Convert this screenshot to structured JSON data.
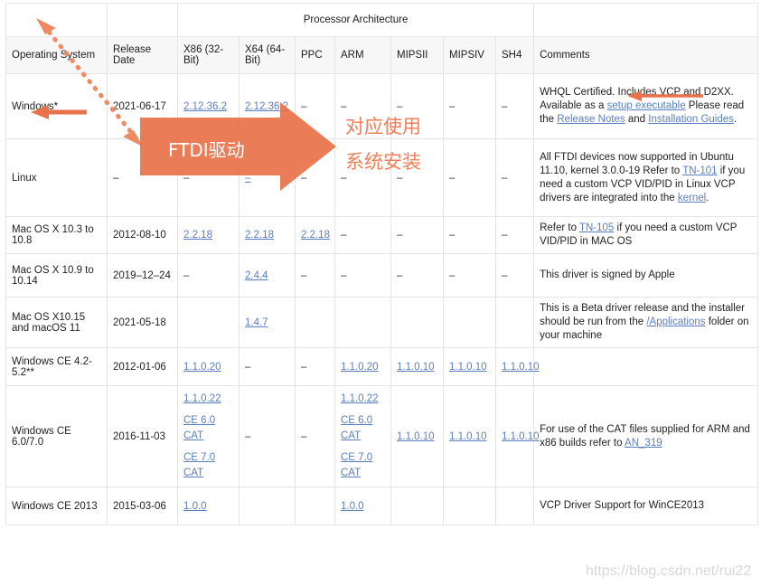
{
  "table": {
    "group_header": {
      "arch_label": "Processor Architecture"
    },
    "columns": [
      "Operating System",
      "Release Date",
      "X86 (32-Bit)",
      "X64 (64-Bit)",
      "PPC",
      "ARM",
      "MIPSII",
      "MIPSIV",
      "SH4",
      "Comments"
    ],
    "rows": [
      {
        "os": "Windows*",
        "date": "2021-06-17",
        "x86": "2.12.36.2",
        "x86_link": true,
        "x64": "2.12.36.2",
        "x64_link": true,
        "ppc": "–",
        "arm": "–",
        "mipsii": "–",
        "mipsiv": "–",
        "sh4": "–",
        "comment_parts": [
          {
            "t": "WHQL Certified. Includes VCP and D2XX. Available as a ",
            "link": false
          },
          {
            "t": "setup executable",
            "link": true
          },
          {
            "t": " Please read the ",
            "link": false
          },
          {
            "t": "Release Notes",
            "link": true
          },
          {
            "t": " and ",
            "link": false
          },
          {
            "t": "Installation Guides",
            "link": true
          },
          {
            "t": ".",
            "link": false
          }
        ]
      },
      {
        "os": "Linux",
        "date": "–",
        "x86": "–",
        "x86_link": false,
        "x64": "–",
        "x64_link": true,
        "ppc": "–",
        "arm": "–",
        "mipsii": "–",
        "mipsiv": "–",
        "sh4": "–",
        "comment_parts": [
          {
            "t": "All FTDI devices now supported in Ubuntu 11.10, kernel 3.0.0-19 Refer to ",
            "link": false
          },
          {
            "t": "TN-101",
            "link": true
          },
          {
            "t": " if you need a custom VCP VID/PID in Linux VCP drivers are integrated into the ",
            "link": false
          },
          {
            "t": "kernel",
            "link": true
          },
          {
            "t": ".",
            "link": false
          }
        ]
      },
      {
        "os": "Mac OS X 10.3 to 10.8",
        "date": "2012-08-10",
        "x86": "2.2.18",
        "x86_link": true,
        "x64": "2.2.18",
        "x64_link": true,
        "ppc": "2.2.18",
        "ppc_link": true,
        "arm": "–",
        "mipsii": "–",
        "mipsiv": "–",
        "sh4": "–",
        "comment_parts": [
          {
            "t": "Refer to ",
            "link": false
          },
          {
            "t": "TN-105",
            "link": true
          },
          {
            "t": " if you need a custom VCP VID/PID in MAC OS",
            "link": false
          }
        ]
      },
      {
        "os": "Mac OS X 10.9 to 10.14",
        "date": "2019–12–24",
        "x86": "–",
        "x86_link": false,
        "x64": "2.4.4",
        "x64_link": true,
        "ppc": "–",
        "arm": "–",
        "mipsii": "–",
        "mipsiv": "–",
        "sh4": "–",
        "comment_parts": [
          {
            "t": "This driver is signed by Apple",
            "link": false
          }
        ]
      },
      {
        "os": "Mac OS X10.15 and macOS 11",
        "date": "2021-05-18",
        "x86": "",
        "x86_link": false,
        "x64": "1.4.7",
        "x64_link": true,
        "ppc": "",
        "arm": "",
        "mipsii": "",
        "mipsiv": "",
        "sh4": "",
        "comment_parts": [
          {
            "t": "This is a Beta driver release and the installer should be run from the ",
            "link": false
          },
          {
            "t": "/Applications",
            "link": true
          },
          {
            "t": " folder on your machine",
            "link": false
          }
        ]
      },
      {
        "os": "Windows CE 4.2-5.2**",
        "date": "2012-01-06",
        "x86": "1.1.0.20",
        "x86_link": true,
        "x64": "–",
        "x64_link": false,
        "ppc": "–",
        "arm": "1.1.0.20",
        "arm_link": true,
        "mipsii": "1.1.0.10",
        "mipsii_link": true,
        "mipsiv": "1.1.0.10",
        "mipsiv_link": true,
        "sh4": "1.1.0.10",
        "sh4_link": true,
        "comment_parts": []
      },
      {
        "os": "Windows CE 6.0/7.0",
        "date": "2016-11-03",
        "x86_stack": [
          "1.1.0.22",
          "CE 6.0 CAT",
          "CE 7.0 CAT"
        ],
        "x64": "–",
        "x64_link": false,
        "ppc": "–",
        "arm_stack": [
          "1.1.0.22",
          "CE 6.0 CAT",
          "CE 7.0 CAT"
        ],
        "mipsii": "1.1.0.10",
        "mipsii_link": true,
        "mipsiv": "1.1.0.10",
        "mipsiv_link": true,
        "sh4": "1.1.0.10",
        "sh4_link": true,
        "comment_parts": [
          {
            "t": "For use of the CAT files supplied for ARM and x86 builds refer to ",
            "link": false
          },
          {
            "t": "AN_319",
            "link": true
          }
        ]
      },
      {
        "os": "Windows CE 2013",
        "date": "2015-03-06",
        "x86": "1.0.0",
        "x86_link": true,
        "x64": "",
        "x64_link": false,
        "ppc": "",
        "arm": "1.0.0",
        "arm_link": true,
        "mipsii": "",
        "mipsiv": "",
        "sh4": "",
        "comment_parts": [
          {
            "t": "VCP Driver Support for WinCE2013",
            "link": false
          }
        ]
      }
    ]
  },
  "annotations": {
    "big_arrow_label": "FTDI驱动",
    "note_line1": "对应使用",
    "note_line2": "系统安装",
    "accent_color": "#e8734a",
    "accent_light": "#ef8a63"
  },
  "watermark": {
    "text": "https://blog.csdn.net/rui22"
  }
}
